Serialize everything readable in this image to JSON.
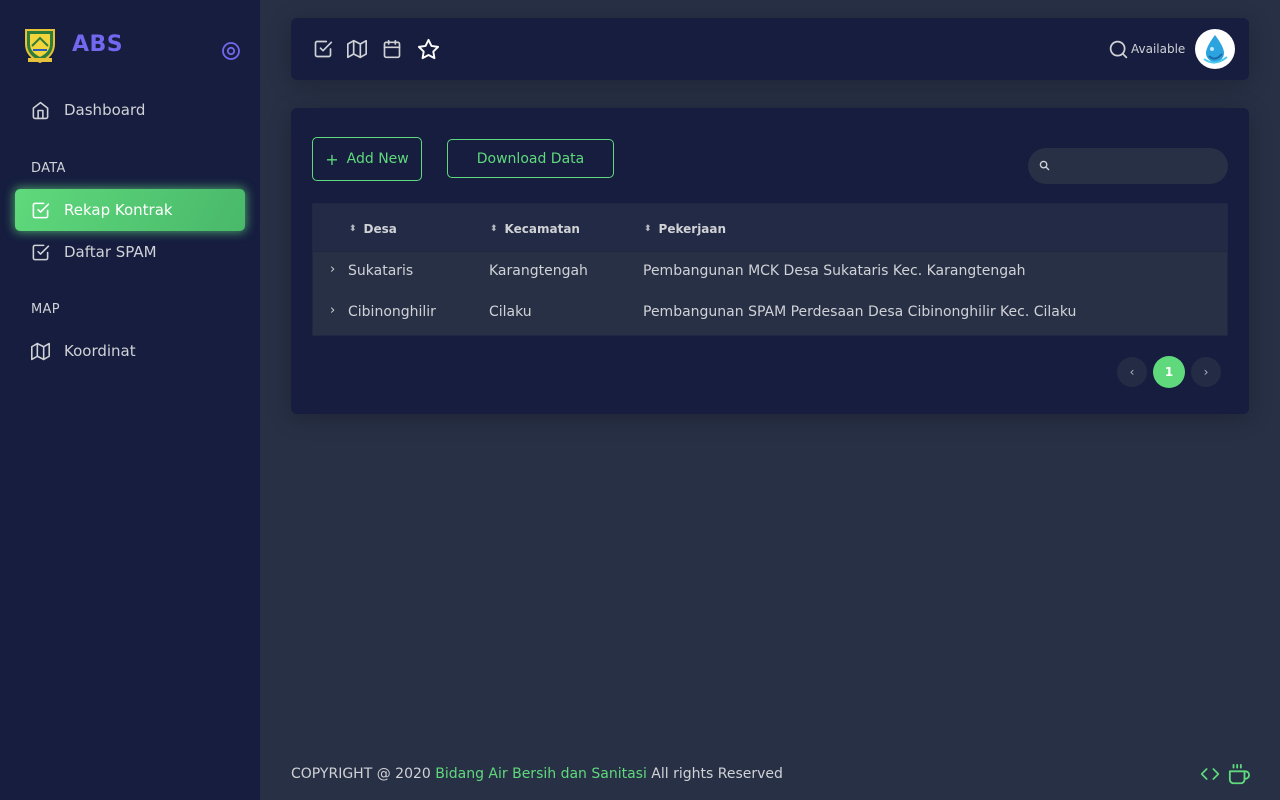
{
  "sidebar": {
    "brand": "ABS",
    "items": [
      {
        "label": "Dashboard",
        "icon": "home-icon"
      },
      {
        "label": "Rekap Kontrak",
        "icon": "check-square-icon",
        "active": true
      },
      {
        "label": "Daftar SPAM",
        "icon": "check-square-icon"
      },
      {
        "label": "Koordinat",
        "icon": "map-icon"
      }
    ],
    "headers": [
      "DATA",
      "MAP"
    ]
  },
  "navbar": {
    "shortcut_icons": [
      "check-square-icon",
      "map-icon",
      "calendar-icon",
      "star-icon"
    ],
    "status": "Available"
  },
  "toolbar": {
    "add_label": "Add New",
    "download_label": "Download Data",
    "search_placeholder": ""
  },
  "table": {
    "columns": [
      "Desa",
      "Kecamatan",
      "Pekerjaan"
    ],
    "rows": [
      {
        "desa": "Sukataris",
        "kecamatan": "Karangtengah",
        "pekerjaan": "Pembangunan MCK Desa Sukataris Kec. Karangtengah"
      },
      {
        "desa": "Cibinonghilir",
        "kecamatan": "Cilaku",
        "pekerjaan": "Pembangunan SPAM Perdesaan Desa Cibinonghilir Kec. Cilaku"
      }
    ]
  },
  "pagination": {
    "prev": "‹",
    "current": "1",
    "next": "›"
  },
  "footer": {
    "prefix": "COPYRIGHT @ 2020",
    "brand": "Bidang Air Bersih dan Sanitasi",
    "suffix": "All rights Reserved"
  },
  "colors": {
    "accent": "#5fd97c",
    "brand": "#7367f0",
    "sidebar_bg": "#161d3f",
    "body_bg": "#283046"
  }
}
